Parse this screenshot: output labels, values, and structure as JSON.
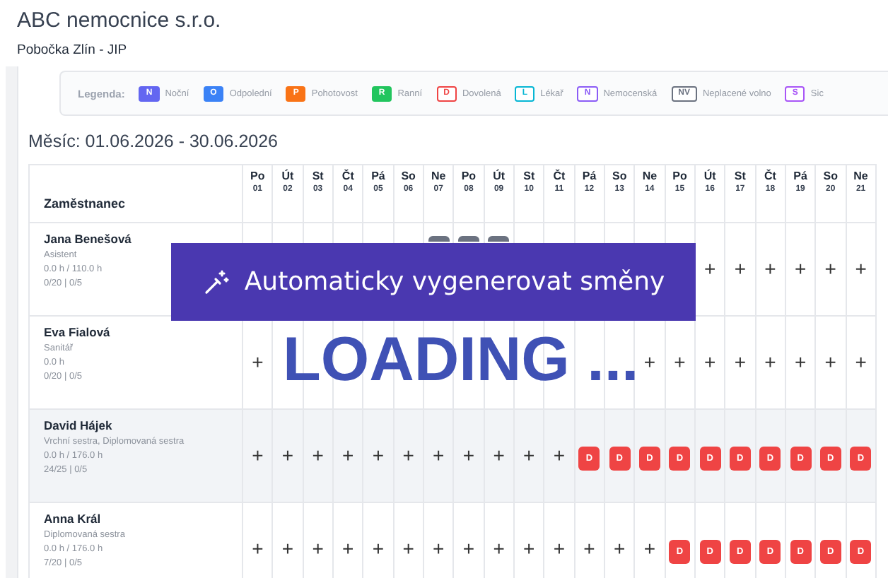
{
  "header": {
    "title": "ABC nemocnice s.r.o.",
    "subtitle": "Pobočka Zlín - JIP"
  },
  "legend": {
    "label": "Legenda:",
    "items": [
      {
        "code": "N",
        "label": "Noční",
        "color": "#6366f1",
        "kind": "filled"
      },
      {
        "code": "O",
        "label": "Odpolední",
        "color": "#3b82f6",
        "kind": "filled"
      },
      {
        "code": "P",
        "label": "Pohotovost",
        "color": "#f97316",
        "kind": "filled"
      },
      {
        "code": "R",
        "label": "Ranní",
        "color": "#22c55e",
        "kind": "filled"
      },
      {
        "code": "D",
        "label": "Dovolená",
        "color": "#ef4444",
        "kind": "outlined"
      },
      {
        "code": "L",
        "label": "Lékař",
        "color": "#06b6d4",
        "kind": "outlined"
      },
      {
        "code": "N",
        "label": "Nemocenská",
        "color": "#8b5cf6",
        "kind": "outlined"
      },
      {
        "code": "NV",
        "label": "Neplacené volno",
        "color": "#6b7280",
        "kind": "outlined"
      },
      {
        "code": "S",
        "label": "Sic",
        "color": "#a855f7",
        "kind": "outlined"
      }
    ]
  },
  "month": "Měsíc: 01.06.2026 - 30.06.2026",
  "table": {
    "employee_header": "Zaměstnanec",
    "days": [
      {
        "weekday": "Po",
        "date": "01"
      },
      {
        "weekday": "Út",
        "date": "02"
      },
      {
        "weekday": "St",
        "date": "03"
      },
      {
        "weekday": "Čt",
        "date": "04"
      },
      {
        "weekday": "Pá",
        "date": "05"
      },
      {
        "weekday": "So",
        "date": "06"
      },
      {
        "weekday": "Ne",
        "date": "07"
      },
      {
        "weekday": "Po",
        "date": "08"
      },
      {
        "weekday": "Út",
        "date": "09"
      },
      {
        "weekday": "St",
        "date": "10"
      },
      {
        "weekday": "Čt",
        "date": "11"
      },
      {
        "weekday": "Pá",
        "date": "12"
      },
      {
        "weekday": "So",
        "date": "13"
      },
      {
        "weekday": "Ne",
        "date": "14"
      },
      {
        "weekday": "Po",
        "date": "15"
      },
      {
        "weekday": "Út",
        "date": "16"
      },
      {
        "weekday": "St",
        "date": "17"
      },
      {
        "weekday": "Čt",
        "date": "18"
      },
      {
        "weekday": "Pá",
        "date": "19"
      },
      {
        "weekday": "So",
        "date": "20"
      },
      {
        "weekday": "Ne",
        "date": "21"
      }
    ],
    "rows": [
      {
        "name": "Jana Benešová",
        "role": "Asistent",
        "hours": "0.0 h / 110.0 h",
        "counts": "0/20 | 0/5",
        "highlighted": false,
        "cells": [
          {
            "kind": "empty"
          },
          {
            "kind": "empty"
          },
          {
            "kind": "empty"
          },
          {
            "kind": "empty"
          },
          {
            "kind": "empty"
          },
          {
            "kind": "empty"
          },
          {
            "kind": "shift-hidden"
          },
          {
            "kind": "shift-hidden"
          },
          {
            "kind": "shift-hidden"
          },
          {
            "kind": "empty"
          },
          {
            "kind": "empty"
          },
          {
            "kind": "empty"
          },
          {
            "kind": "empty"
          },
          {
            "kind": "empty"
          },
          {
            "kind": "empty"
          },
          {
            "kind": "add",
            "text": "+"
          },
          {
            "kind": "add",
            "text": "+"
          },
          {
            "kind": "add",
            "text": "+"
          },
          {
            "kind": "add",
            "text": "+"
          },
          {
            "kind": "add",
            "text": "+"
          },
          {
            "kind": "add",
            "text": "+"
          }
        ]
      },
      {
        "name": "Eva Fialová",
        "role": "Sanitář",
        "hours": "0.0 h",
        "counts": "0/20 | 0/5",
        "highlighted": false,
        "cells": [
          {
            "kind": "add",
            "text": "+"
          },
          {
            "kind": "empty"
          },
          {
            "kind": "empty"
          },
          {
            "kind": "empty"
          },
          {
            "kind": "empty"
          },
          {
            "kind": "empty"
          },
          {
            "kind": "empty"
          },
          {
            "kind": "empty"
          },
          {
            "kind": "empty"
          },
          {
            "kind": "empty"
          },
          {
            "kind": "empty"
          },
          {
            "kind": "empty"
          },
          {
            "kind": "empty"
          },
          {
            "kind": "add",
            "text": "+"
          },
          {
            "kind": "add",
            "text": "+"
          },
          {
            "kind": "add",
            "text": "+"
          },
          {
            "kind": "add",
            "text": "+"
          },
          {
            "kind": "add",
            "text": "+"
          },
          {
            "kind": "add",
            "text": "+"
          },
          {
            "kind": "add",
            "text": "+"
          },
          {
            "kind": "add",
            "text": "+"
          }
        ]
      },
      {
        "name": "David Hájek",
        "role": "Vrchní sestra, Diplomovaná sestra",
        "hours": "0.0 h / 176.0 h",
        "counts": "24/25 | 0/5",
        "highlighted": true,
        "cells": [
          {
            "kind": "add",
            "text": "+"
          },
          {
            "kind": "add",
            "text": "+"
          },
          {
            "kind": "add",
            "text": "+"
          },
          {
            "kind": "add",
            "text": "+"
          },
          {
            "kind": "add",
            "text": "+"
          },
          {
            "kind": "add",
            "text": "+"
          },
          {
            "kind": "add",
            "text": "+"
          },
          {
            "kind": "add",
            "text": "+"
          },
          {
            "kind": "add",
            "text": "+"
          },
          {
            "kind": "add",
            "text": "+"
          },
          {
            "kind": "add",
            "text": "+"
          },
          {
            "kind": "shift",
            "text": "D"
          },
          {
            "kind": "shift",
            "text": "D"
          },
          {
            "kind": "shift",
            "text": "D"
          },
          {
            "kind": "shift",
            "text": "D"
          },
          {
            "kind": "shift",
            "text": "D"
          },
          {
            "kind": "shift",
            "text": "D"
          },
          {
            "kind": "shift",
            "text": "D"
          },
          {
            "kind": "shift",
            "text": "D"
          },
          {
            "kind": "shift",
            "text": "D"
          },
          {
            "kind": "shift",
            "text": "D"
          }
        ]
      },
      {
        "name": "Anna Král",
        "role": "Diplomovaná sestra",
        "hours": "0.0 h / 176.0 h",
        "counts": "7/20 | 0/5",
        "highlighted": false,
        "cells": [
          {
            "kind": "add",
            "text": "+"
          },
          {
            "kind": "add",
            "text": "+"
          },
          {
            "kind": "add",
            "text": "+"
          },
          {
            "kind": "add",
            "text": "+"
          },
          {
            "kind": "add",
            "text": "+"
          },
          {
            "kind": "add",
            "text": "+"
          },
          {
            "kind": "add",
            "text": "+"
          },
          {
            "kind": "add",
            "text": "+"
          },
          {
            "kind": "add",
            "text": "+"
          },
          {
            "kind": "add",
            "text": "+"
          },
          {
            "kind": "add",
            "text": "+"
          },
          {
            "kind": "add",
            "text": "+"
          },
          {
            "kind": "add",
            "text": "+"
          },
          {
            "kind": "add",
            "text": "+"
          },
          {
            "kind": "shift",
            "text": "D"
          },
          {
            "kind": "shift",
            "text": "D"
          },
          {
            "kind": "shift",
            "text": "D"
          },
          {
            "kind": "shift",
            "text": "D"
          },
          {
            "kind": "shift",
            "text": "D"
          },
          {
            "kind": "shift",
            "text": "D"
          },
          {
            "kind": "shift",
            "text": "D"
          }
        ]
      }
    ]
  },
  "generate_button": {
    "label": "Automaticky vygenerovat směny"
  },
  "loading": "LOADING ..."
}
